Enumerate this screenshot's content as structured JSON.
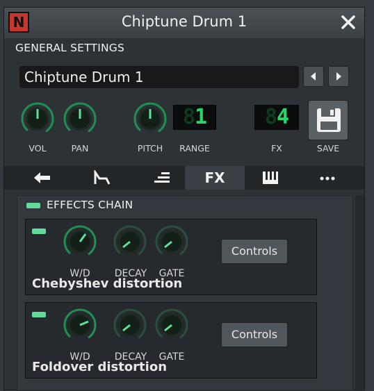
{
  "window": {
    "title": "Chiptune Drum 1",
    "app_icon_letter": "N"
  },
  "general": {
    "section_label": "GENERAL SETTINGS",
    "instrument_name": "Chiptune Drum 1",
    "labels": {
      "vol": "VOL",
      "pan": "PAN",
      "pitch": "PITCH",
      "range": "RANGE",
      "fx": "FX",
      "save": "SAVE"
    },
    "range_display": "1",
    "fx_display": "4"
  },
  "tabs": [
    {
      "name": "tab-plugin",
      "icon": "plug-arrow-icon"
    },
    {
      "name": "tab-envelope",
      "icon": "envelope-icon"
    },
    {
      "name": "tab-functions",
      "icon": "bars-icon"
    },
    {
      "name": "tab-fx",
      "label": "FX",
      "active": true
    },
    {
      "name": "tab-midi",
      "icon": "piano-keys-icon"
    },
    {
      "name": "tab-misc",
      "icon": "ellipsis-icon"
    }
  ],
  "effects_chain": {
    "label": "EFFECTS CHAIN",
    "effects": [
      {
        "name": "Chebyshev distortion",
        "wd_label": "W/D",
        "decay_label": "DECAY",
        "gate_label": "GATE",
        "controls_label": "Controls",
        "enabled": true
      },
      {
        "name": "Foldover distortion",
        "wd_label": "W/D",
        "decay_label": "DECAY",
        "gate_label": "GATE",
        "controls_label": "Controls",
        "enabled": true
      }
    ]
  },
  "colors": {
    "accent_green": "#27d66a",
    "led_green": "#5fdc9a",
    "app_icon_red": "#c8362c"
  }
}
